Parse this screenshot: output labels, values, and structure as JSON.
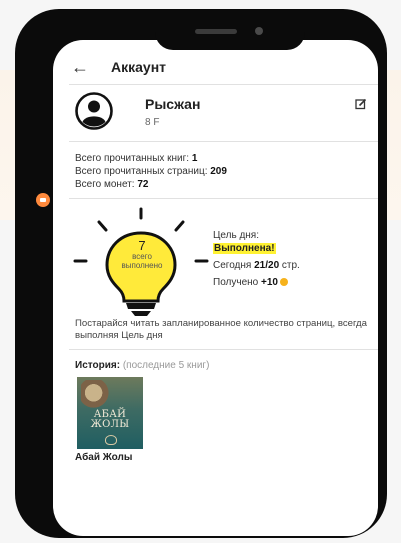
{
  "appbar": {
    "back_icon": "back-arrow-icon",
    "title": "Аккаунт"
  },
  "profile": {
    "avatar_icon": "user-avatar-icon",
    "name": "Рысжан",
    "class": "8 F",
    "edit_icon": "edit-icon"
  },
  "stats": {
    "books_label": "Всего прочитанных книг: ",
    "books_value": "1",
    "pages_label": "Всего прочитанных страниц: ",
    "pages_value": "209",
    "coins_label": "Всего монет: ",
    "coins_value": "72"
  },
  "goal": {
    "count": "7",
    "count_caption_1": "всего",
    "count_caption_2": "выполнено",
    "label": "Цель дня:",
    "status": "Выполнена!",
    "today_label": "Сегодня ",
    "today_value": "21/20",
    "today_unit": " стр.",
    "reward_label": "Получено ",
    "reward_value": "+10",
    "coin_icon": "coin-icon",
    "highlight_color": "#fff233",
    "bulb_color": "#ffea3a"
  },
  "hint": "Постарайся читать запланированное количество страниц, всегда выполняя Цель дня",
  "history": {
    "title": "История:",
    "subtitle": " (последние 5 книг)",
    "books": [
      {
        "cover_title_1": "АБАЙ",
        "cover_title_2": "ЖОЛЫ",
        "name": "Абай Жолы"
      }
    ]
  }
}
